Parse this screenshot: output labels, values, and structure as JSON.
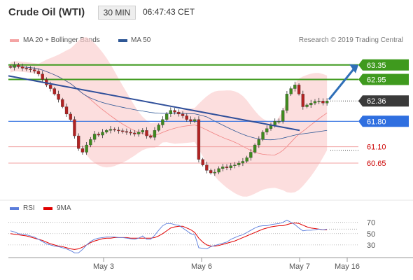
{
  "header": {
    "title": "Crude Oil (WTI)",
    "timeframe": "30 MIN",
    "time": "06:47:43 CET"
  },
  "legend": {
    "bollinger_label": "MA 20 + Bollinger Bands",
    "ma50_label": "MA 50",
    "credit": "Research © 2019 Trading Central",
    "colors": {
      "bollinger": "#f08080",
      "ma50": "#2f5896"
    }
  },
  "indicator_legend": {
    "rsi_label": "RSI",
    "ma_label": "9MA",
    "colors": {
      "rsi": "#5b7ddb",
      "ma": "#e00000"
    }
  },
  "chart_data": {
    "type": "candlestick",
    "instrument": "Crude Oil (WTI)",
    "timeframe": "30 MIN",
    "ylim": [
      59.9,
      63.75
    ],
    "x_tick_labels": [
      "May 3",
      "May 6",
      "May 7",
      "May 16"
    ],
    "closes": [
      63.28,
      63.35,
      63.3,
      63.26,
      63.24,
      63.22,
      63.18,
      63.1,
      62.95,
      62.8,
      62.7,
      62.55,
      62.4,
      62.2,
      62.0,
      61.85,
      61.4,
      61.05,
      60.95,
      61.15,
      61.3,
      61.45,
      61.42,
      61.5,
      61.55,
      61.58,
      61.56,
      61.54,
      61.52,
      61.5,
      61.48,
      61.45,
      61.5,
      61.55,
      61.4,
      61.36,
      61.55,
      61.7,
      61.85,
      62.0,
      62.1,
      62.05,
      62.0,
      61.95,
      61.85,
      61.8,
      61.85,
      60.75,
      60.6,
      60.45,
      60.38,
      60.4,
      60.5,
      60.55,
      60.52,
      60.58,
      60.6,
      60.65,
      60.7,
      60.8,
      60.95,
      61.15,
      61.3,
      61.5,
      61.6,
      61.7,
      61.8,
      61.8,
      62.1,
      62.55,
      62.7,
      62.8,
      62.55,
      62.2,
      62.25,
      62.3,
      62.35,
      62.36,
      62.3,
      62.36
    ],
    "forecast_levels": [
      {
        "value": 63.35,
        "label": "63.35",
        "kind": "resistance"
      },
      {
        "value": 62.95,
        "label": "62.95",
        "kind": "resistance"
      },
      {
        "value": 62.36,
        "label": "62.36",
        "kind": "last"
      },
      {
        "value": 61.8,
        "label": "61.80",
        "kind": "pivot"
      },
      {
        "value": 61.1,
        "label": "61.10",
        "kind": "support"
      },
      {
        "value": 60.65,
        "label": "60.65",
        "kind": "support"
      }
    ],
    "trendline": {
      "start": 63.05,
      "end": 61.55
    },
    "forecast_arrow": {
      "from": 62.4,
      "to": 63.35
    },
    "indicator": {
      "name": "RSI",
      "ma_name": "9MA",
      "levels": [
        70,
        50,
        30
      ],
      "ylim": [
        10,
        82
      ],
      "rsi_values": [
        55,
        53,
        50,
        49,
        48,
        46,
        44,
        40,
        36,
        32,
        30,
        28,
        27,
        25,
        23,
        20,
        16,
        16,
        22,
        30,
        36,
        40,
        42,
        43,
        44,
        44,
        44,
        43,
        43,
        42,
        41,
        40,
        42,
        46,
        40,
        40,
        47,
        56,
        64,
        68,
        68,
        66,
        65,
        60,
        55,
        50,
        48,
        25,
        24,
        23,
        27,
        29,
        31,
        33,
        35,
        40,
        43,
        46,
        48,
        52,
        56,
        60,
        63,
        64,
        64,
        66,
        67,
        68,
        70,
        74,
        70,
        66,
        60,
        55,
        56,
        56,
        57,
        58,
        57,
        58
      ],
      "ma_values": [
        50,
        49,
        48,
        47,
        46,
        44,
        42,
        40,
        38,
        35,
        32,
        30,
        28,
        27,
        25,
        23,
        22,
        23,
        26,
        30,
        34,
        37,
        39,
        41,
        42,
        42,
        43,
        43,
        43,
        43,
        42,
        42,
        42,
        42,
        42,
        42,
        43,
        46,
        50,
        55,
        60,
        62,
        63,
        63,
        60,
        57,
        52,
        42,
        35,
        30,
        28,
        28,
        29,
        31,
        33,
        35,
        37,
        40,
        43,
        46,
        49,
        52,
        55,
        58,
        60,
        62,
        63,
        64,
        64,
        66,
        68,
        69,
        68,
        65,
        62,
        60,
        59,
        58,
        57,
        57
      ]
    }
  }
}
